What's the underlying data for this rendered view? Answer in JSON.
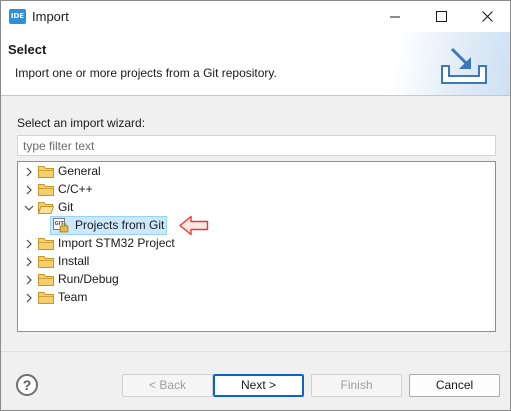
{
  "window": {
    "app_icon_text": "IDE",
    "title": "Import",
    "controls": [
      "minimize-icon",
      "maximize-icon",
      "close-icon"
    ]
  },
  "banner": {
    "title": "Select",
    "description": "Import one or more projects from a Git repository.",
    "icon": "import-tray-icon"
  },
  "wizard": {
    "label": "Select an import wizard:",
    "filter_placeholder": "type filter text",
    "filter_value": ""
  },
  "tree": {
    "items": [
      {
        "label": "General",
        "expanded": false,
        "icon": "folder-icon"
      },
      {
        "label": "C/C++",
        "expanded": false,
        "icon": "folder-icon"
      },
      {
        "label": "Git",
        "expanded": true,
        "icon": "folder-icon"
      },
      {
        "label": "Import STM32 Project",
        "expanded": false,
        "icon": "folder-icon"
      },
      {
        "label": "Install",
        "expanded": false,
        "icon": "folder-icon"
      },
      {
        "label": "Run/Debug",
        "expanded": false,
        "icon": "folder-icon"
      },
      {
        "label": "Team",
        "expanded": false,
        "icon": "folder-icon"
      }
    ],
    "child_of_git": {
      "label": "Projects from Git",
      "icon": "git-projects-icon",
      "selected": true
    },
    "annotation_arrow_color": "#e53935"
  },
  "buttons": {
    "help": "?",
    "back": "< Back",
    "next": "Next >",
    "finish": "Finish",
    "cancel": "Cancel"
  },
  "colors": {
    "selection_bg": "#cce8ff",
    "primary_border": "#0a64c8",
    "folder": "#e8b84a"
  }
}
